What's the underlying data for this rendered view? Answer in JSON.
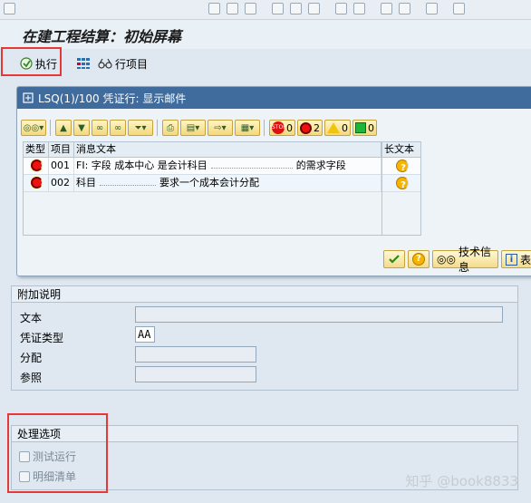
{
  "screen_title": "在建工程结算：初始屏幕",
  "toolbar": {
    "execute_label": "执行",
    "line_items_label": "行项目"
  },
  "popup": {
    "title": "LSQ(1)/100 凭证行: 显示邮件",
    "counts": {
      "stop": "0",
      "error": "2",
      "warning": "0",
      "success": "0"
    },
    "columns": {
      "type": "类型",
      "item": "项目",
      "message": "消息文本",
      "long_text": "长文本"
    },
    "rows": [
      {
        "item": "001",
        "message_prefix": "FI: 字段 成本中心 是会计科目",
        "message_suffix": "的需求字段"
      },
      {
        "item": "002",
        "message_prefix": "科目",
        "message_suffix": "要求一个成本会计分配"
      }
    ],
    "footer": {
      "tech_info_label": "技术信息",
      "more_label": "表"
    }
  },
  "additional_section": {
    "title": "附加说明",
    "fields": {
      "text_label": "文本",
      "doc_type_label": "凭证类型",
      "doc_type_value": "AA",
      "allocation_label": "分配",
      "reference_label": "参照"
    }
  },
  "processing_section": {
    "title": "处理选项",
    "test_run_label": "测试运行",
    "detail_list_label": "明细清单"
  },
  "watermark": "知乎 @book8833"
}
